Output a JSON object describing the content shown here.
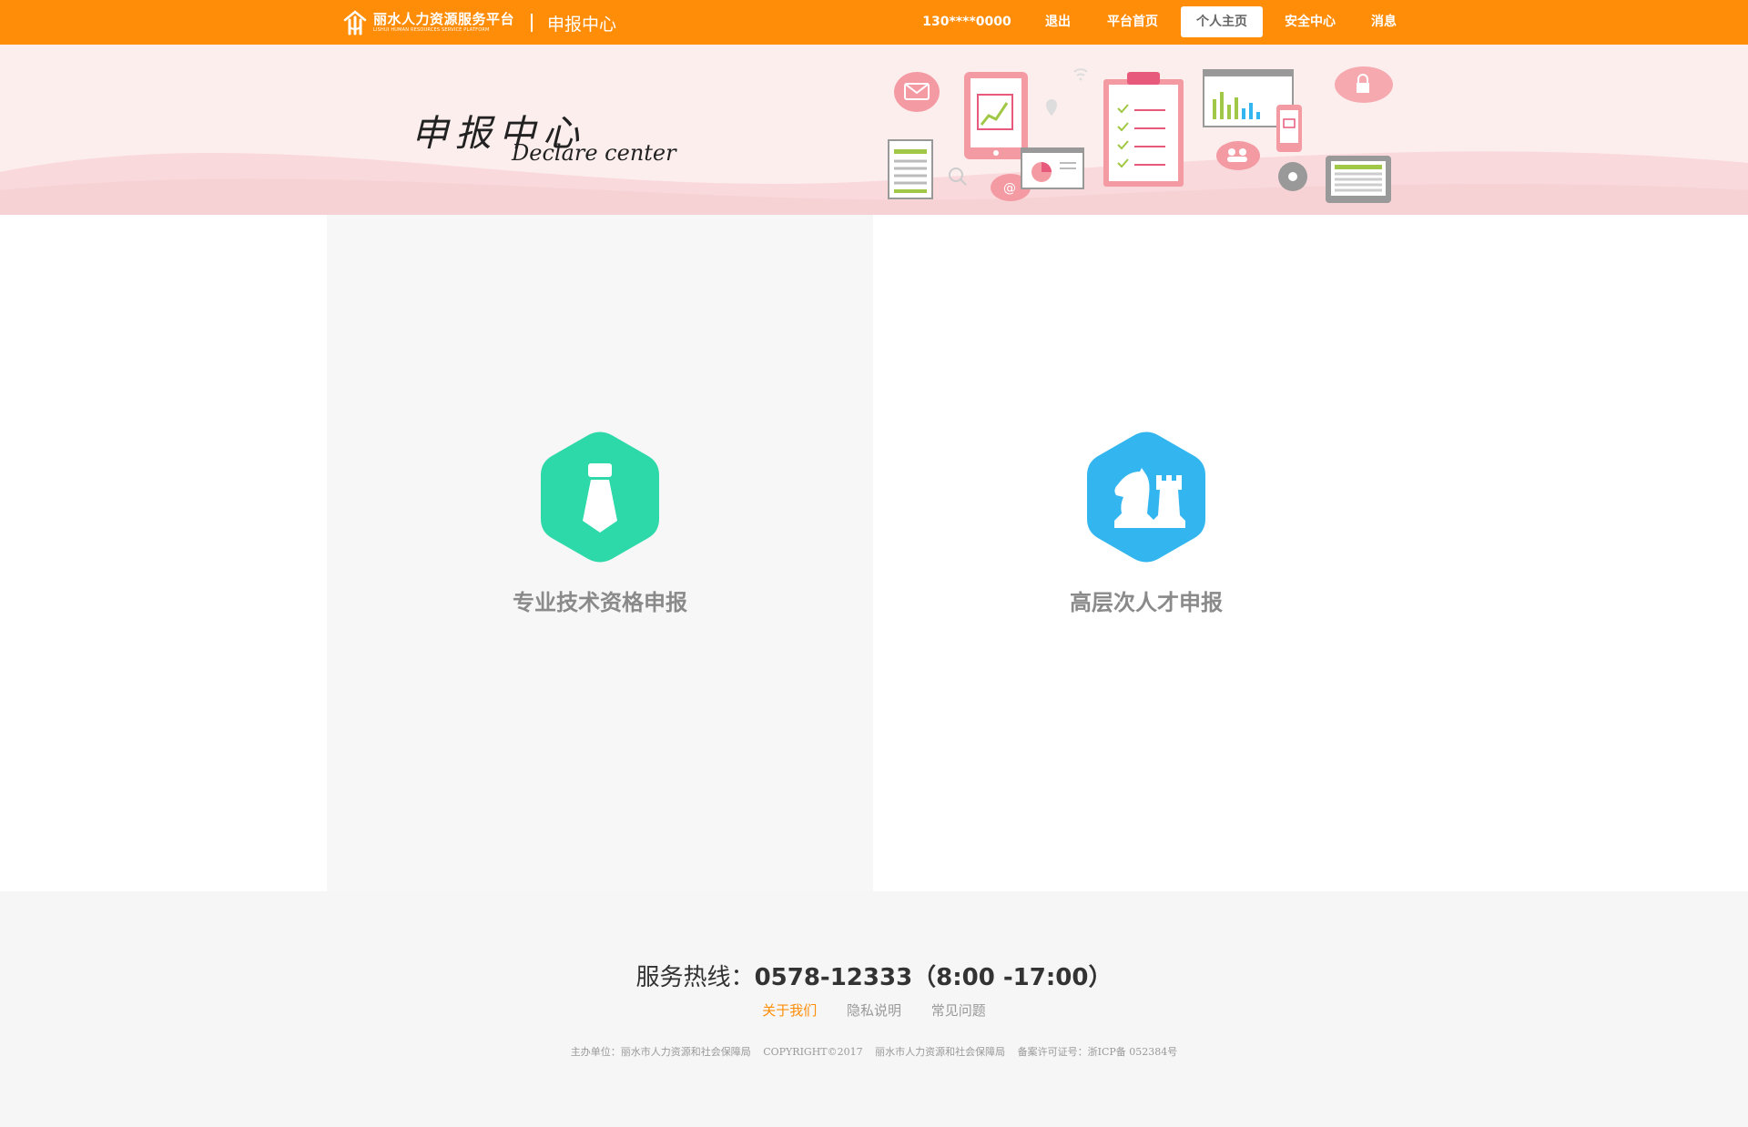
{
  "header": {
    "logo_cn": "丽水人力资源服务平台",
    "logo_en": "LISHUI HUMAN RESOURCES SERVICE PLATFORM",
    "subtitle": "申报中心",
    "brand_color": "#ff8d07",
    "nav": [
      {
        "label": "130****0000",
        "active": false
      },
      {
        "label": "退出",
        "active": false
      },
      {
        "label": "平台首页",
        "active": false
      },
      {
        "label": "个人主页",
        "active": true
      },
      {
        "label": "安全中心",
        "active": false
      },
      {
        "label": "消息",
        "active": false
      }
    ]
  },
  "banner": {
    "title_cn": "申报中心",
    "title_en": "Declare center"
  },
  "main": {
    "cards": [
      {
        "label": "专业技术资格申报",
        "icon": "tie-icon",
        "color": "#2dd8a9"
      },
      {
        "label": "高层次人才申报",
        "icon": "chess-icon",
        "color": "#33b6f0"
      }
    ]
  },
  "footer": {
    "hotline_label": "服务热线：",
    "hotline_number": "0578-12333（8:00 -17:00）",
    "links": [
      {
        "label": "关于我们",
        "highlight": true
      },
      {
        "label": "隐私说明",
        "highlight": false
      },
      {
        "label": "常见问题",
        "highlight": false
      }
    ],
    "copyright": [
      "主办单位：丽水市人力资源和社会保障局",
      "COPYRIGHT©2017",
      "丽水市人力资源和社会保障局",
      "备案许可证号：浙ICP备 052384号"
    ]
  }
}
